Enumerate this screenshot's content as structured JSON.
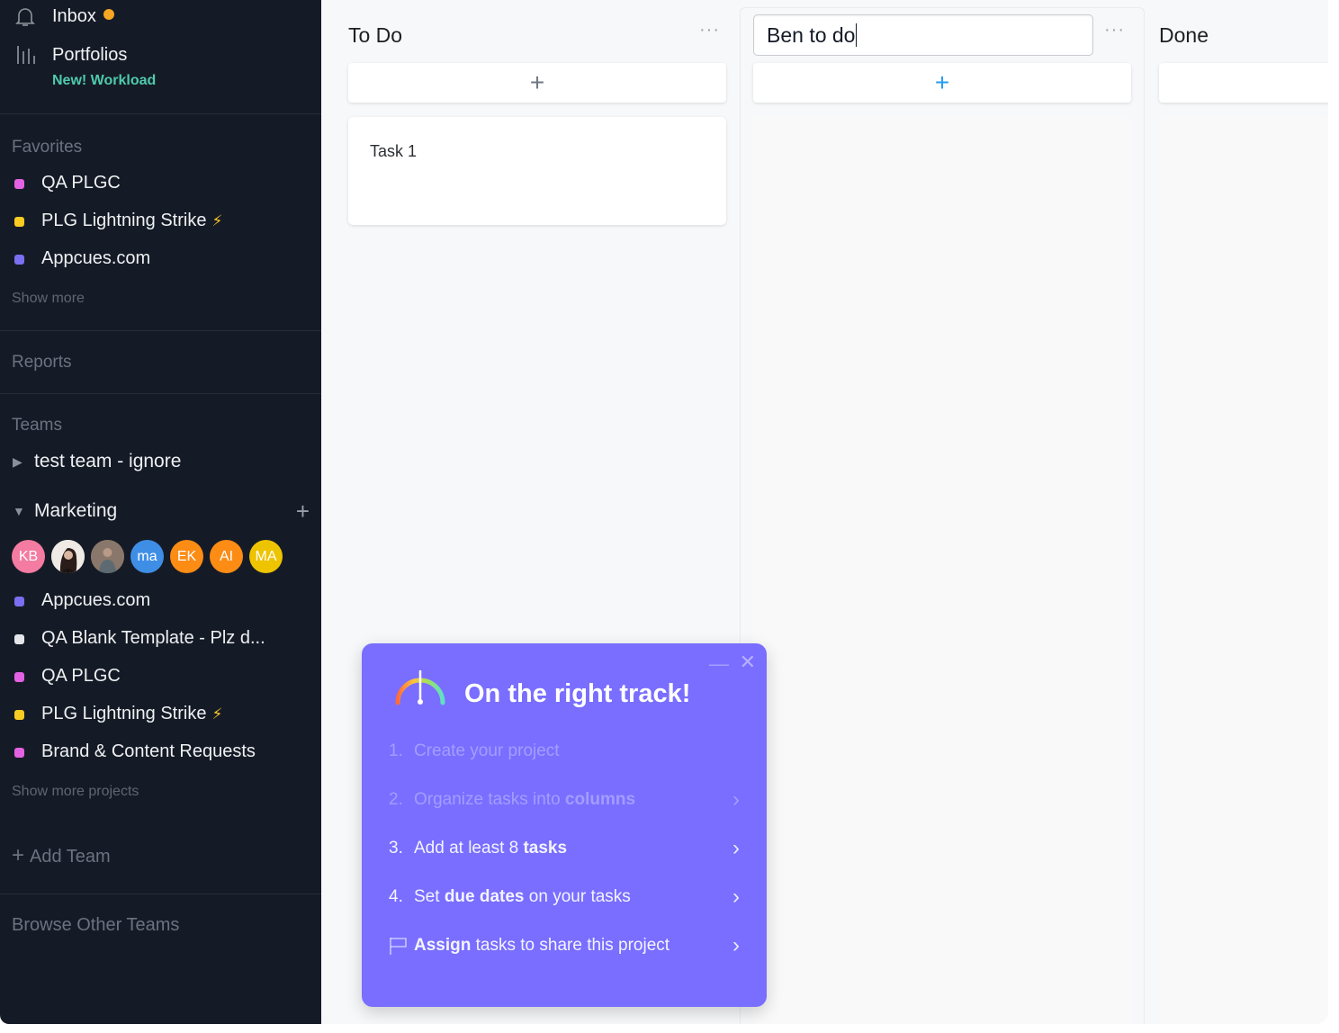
{
  "sidebar": {
    "nav": {
      "inbox_label": "Inbox",
      "inbox_has_unread": true,
      "portfolios_label": "Portfolios",
      "workload_label": "New! Workload"
    },
    "favorites": {
      "title": "Favorites",
      "items": [
        {
          "label": "QA PLGC",
          "color": "#e362e3",
          "emoji": ""
        },
        {
          "label": "PLG Lightning Strike",
          "color": "#f8cc22",
          "emoji": "⚡"
        },
        {
          "label": "Appcues.com",
          "color": "#7a6ff0",
          "emoji": ""
        }
      ],
      "show_more": "Show more"
    },
    "reports_label": "Reports",
    "teams": {
      "title": "Teams",
      "collapsed_team": "test team - ignore",
      "expanded_team": "Marketing",
      "members": [
        {
          "initials": "KB",
          "color": "#f47ba1",
          "photo": false
        },
        {
          "initials": "",
          "color": "#e9e4df",
          "photo": true
        },
        {
          "initials": "",
          "color": "#7c6a5e",
          "photo": true
        },
        {
          "initials": "ma",
          "color": "#3f8ee6",
          "photo": false
        },
        {
          "initials": "EK",
          "color": "#fd8c15",
          "photo": false
        },
        {
          "initials": "AI",
          "color": "#fd8c15",
          "photo": false
        },
        {
          "initials": "MA",
          "color": "#eec300",
          "photo": false
        }
      ],
      "projects": [
        {
          "label": "Appcues.com",
          "color": "#7a6ff0",
          "emoji": ""
        },
        {
          "label": "QA Blank Template - Plz d...",
          "color": "#e4e6ea",
          "emoji": ""
        },
        {
          "label": "QA PLGC",
          "color": "#e362e3",
          "emoji": ""
        },
        {
          "label": "PLG Lightning Strike",
          "color": "#f8cc22",
          "emoji": "⚡"
        },
        {
          "label": "Brand & Content Requests",
          "color": "#e362e3",
          "emoji": ""
        }
      ],
      "show_more_projects": "Show more projects"
    },
    "add_team_label": "Add Team",
    "browse_teams_label": "Browse Other Teams"
  },
  "board": {
    "columns": [
      {
        "title": "To Do",
        "tasks": [
          "Task 1"
        ],
        "add_icon_color": "#6f7782"
      },
      {
        "title_input_value": "Ben to do",
        "editing": true,
        "tasks": [],
        "add_icon_color": "#2a9bf0"
      },
      {
        "title": "Done",
        "tasks": []
      }
    ],
    "menu_glyph": "···"
  },
  "guide": {
    "title": "On the right track!",
    "steps": [
      {
        "num": "1.",
        "pre": "Create your project",
        "bold": "",
        "post": "",
        "done": true,
        "chevron": false
      },
      {
        "num": "2.",
        "pre": "Organize tasks into ",
        "bold": "columns",
        "post": "",
        "done": true,
        "chevron": true
      },
      {
        "num": "3.",
        "pre": "Add at least 8 ",
        "bold": "tasks",
        "post": "",
        "done": false,
        "chevron": true
      },
      {
        "num": "4.",
        "pre": "Set ",
        "bold": "due dates",
        "post": " on your tasks",
        "done": false,
        "chevron": true
      },
      {
        "num": "",
        "pre": "",
        "bold": "Assign",
        "post": " tasks to share this project",
        "done": false,
        "chevron": true,
        "flag_icon": true
      }
    ],
    "background": "#796eff"
  }
}
